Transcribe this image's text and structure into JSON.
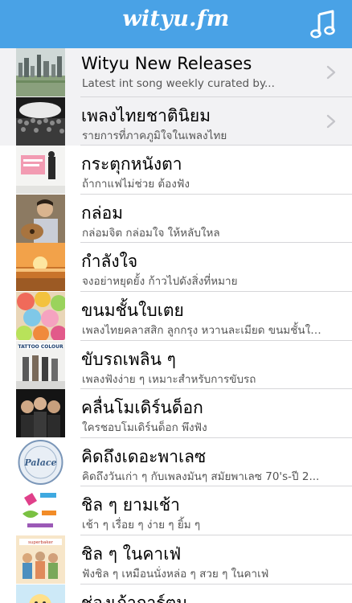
{
  "app": {
    "logo_text": "wityu.fm",
    "music_icon": "music-note-icon",
    "accent_color": "#49a2e6"
  },
  "playlists": [
    {
      "title": "Wityu New Releases",
      "subtitle": "Latest int song weekly curated by...",
      "disclosure": true,
      "thumb": "city-skyline"
    },
    {
      "title": "เพลงไทยชาตินิยม",
      "subtitle": "รายการที่ภาคภูมิใจในเพลงไทย",
      "disclosure": true,
      "thumb": "concert-crowd"
    },
    {
      "title": "กระตุกหนังตา",
      "subtitle": "ถ้ากาแฟไม่ช่วย ต้องฟัง",
      "disclosure": false,
      "thumb": "album-pink"
    },
    {
      "title": "กล่อม",
      "subtitle": "กล่อมจิต กล่อมใจ ให้หลับใหล",
      "disclosure": false,
      "thumb": "guitarist"
    },
    {
      "title": "กำลังใจ",
      "subtitle": "จงอย่าหยุดยั้ง ก้าวไปดังสิ่งที่หมาย",
      "disclosure": false,
      "thumb": "sunset-beach"
    },
    {
      "title": "ขนมชั้นใบเตย",
      "subtitle": "เพลงไทยคลาสสิก ลูกกรุง หวานละเมียด ขนมชั้นใบเตย",
      "disclosure": false,
      "thumb": "candy"
    },
    {
      "title": "ขับรถเพลิน ๆ",
      "subtitle": "เพลงฟังง่าย ๆ เหมาะสำหรับการขับรถ",
      "disclosure": false,
      "thumb": "tattoo-colour"
    },
    {
      "title": "คลื่นโมเดิร์นด็อก",
      "subtitle": "ใครชอบโมเดิร์นด็อก พึงฟัง",
      "disclosure": false,
      "thumb": "band-dark"
    },
    {
      "title": "คิดถึงเดอะพาเลซ",
      "subtitle": "คิดถึงวันเก่า ๆ กับเพลงมันๆ สมัยพาเลซ 70's-ปี 2...",
      "disclosure": false,
      "thumb": "palace-badge"
    },
    {
      "title": "ชิล ๆ ยามเช้า",
      "subtitle": "เช้า ๆ เรื่อย ๆ ง่าย ๆ ยิ้ม ๆ",
      "disclosure": false,
      "thumb": "love-logo"
    },
    {
      "title": "ชิล ๆ ในคาเฟ่",
      "subtitle": "ฟังชิล ๆ เหมือนนั่งหล่อ ๆ สวย ๆ ในคาเฟ่",
      "disclosure": false,
      "thumb": "superbaker"
    },
    {
      "title": "ช่องเก้าการ์ตูน",
      "subtitle": "",
      "disclosure": false,
      "thumb": "cartoon"
    }
  ]
}
